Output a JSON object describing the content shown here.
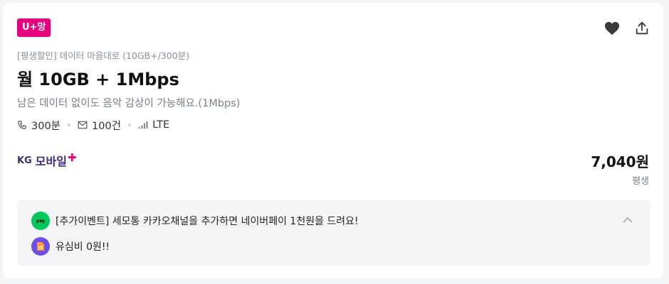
{
  "badge": {
    "label": "U+망",
    "color": "#e6007e"
  },
  "actions": {
    "favorite_icon": "heart-icon",
    "share_icon": "share-icon"
  },
  "plan": {
    "subtitle": "[평생할인] 데이터 마음대로 (10GB+/300분)",
    "title": "월 10GB + 1Mbps",
    "description": "남은 데이터 없이도 음악 감상이 가능해요.(1Mbps)"
  },
  "specs": {
    "voice": "300분",
    "sms": "100건",
    "network": "LTE"
  },
  "carrier": {
    "kg": "KG",
    "name": "모바일",
    "plus": "✚"
  },
  "price": {
    "amount": "7,040원",
    "period": "평생"
  },
  "events": [
    {
      "text": "[추가이벤트] 세모통 카카오채널을 추가하면 네이버페이 1천원을 드려요!",
      "icon": "naverpay-icon"
    },
    {
      "text": "유심비 0원!!",
      "icon": "sim-card-icon"
    }
  ],
  "events_icon_label": "pay"
}
